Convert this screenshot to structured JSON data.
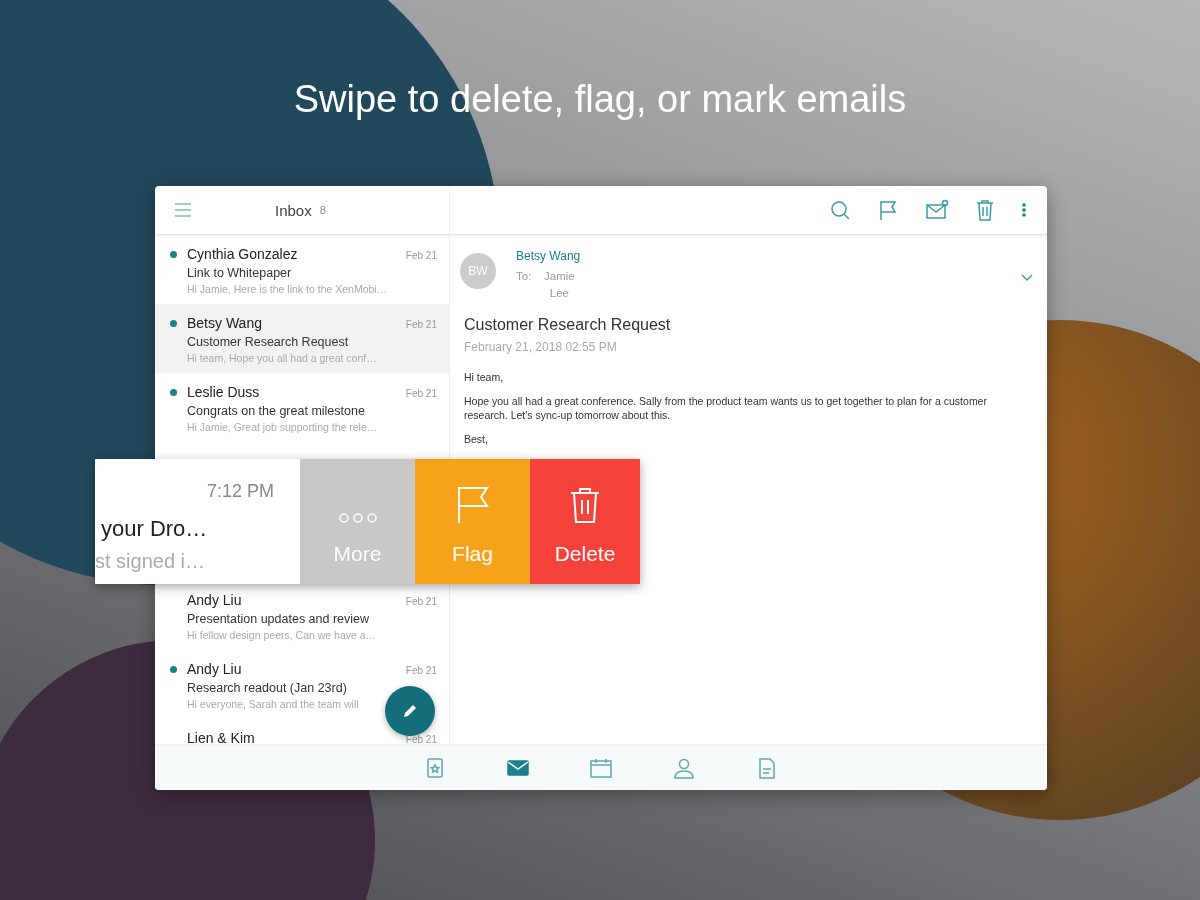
{
  "headline": "Swipe to delete, flag, or mark emails",
  "inbox": {
    "title": "Inbox",
    "count": "8"
  },
  "messages": [
    {
      "sender": "Cynthia Gonzalez",
      "date": "Feb 21",
      "subject": "Link to Whitepaper",
      "preview": "Hi Jamie, Here is the link to the XenMobi…",
      "unread": true,
      "selected": false
    },
    {
      "sender": "Betsy Wang",
      "date": "Feb 21",
      "subject": "Customer Research Request",
      "preview": "Hi team, Hope you all had a great conf…",
      "unread": true,
      "selected": true
    },
    {
      "sender": "Leslie Duss",
      "date": "Feb 21",
      "subject": "Congrats on the great milestone",
      "preview": "Hi Jamie, Great job supporting the rele…",
      "unread": true,
      "selected": false
    }
  ],
  "swiped_message": {
    "time": "7:12 PM",
    "subject": "your Dro…",
    "preview": "st signed i…"
  },
  "swipe_actions": [
    {
      "kind": "more",
      "label": "More"
    },
    {
      "kind": "flag",
      "label": "Flag"
    },
    {
      "kind": "delete",
      "label": "Delete"
    }
  ],
  "messages_below": [
    {
      "sender": "Andy Liu",
      "date": "Feb 21",
      "subject": "Presentation updates and review",
      "preview": "Hi fellow design peers, Can we have a…",
      "unread": false,
      "selected": false
    },
    {
      "sender": "Andy Liu",
      "date": "Feb 21",
      "subject": "Research readout (Jan 23rd)",
      "preview": "Hi everyone, Sarah and the team will",
      "unread": true,
      "selected": false
    },
    {
      "sender": "Lien & Kim",
      "date": "Feb 21",
      "unread": false,
      "selected": false
    }
  ],
  "reading": {
    "avatar": "BW",
    "sender": "Betsy Wang",
    "to_label": "To:",
    "to": "Jamie Lee",
    "subject": "Customer Research Request",
    "date": "February 21, 2018 02:55 PM",
    "body": [
      "Hi team,",
      "Hope you all had a great conference. Sally from the product team wants us to get together to plan for a customer research. Let's sync-up tomorrow about this.",
      "Best,"
    ]
  },
  "bottom_nav": [
    {
      "kind": "focus",
      "selected": false
    },
    {
      "kind": "mail",
      "selected": true
    },
    {
      "kind": "calendar",
      "selected": false
    },
    {
      "kind": "contacts",
      "selected": false
    },
    {
      "kind": "files",
      "selected": false
    }
  ]
}
